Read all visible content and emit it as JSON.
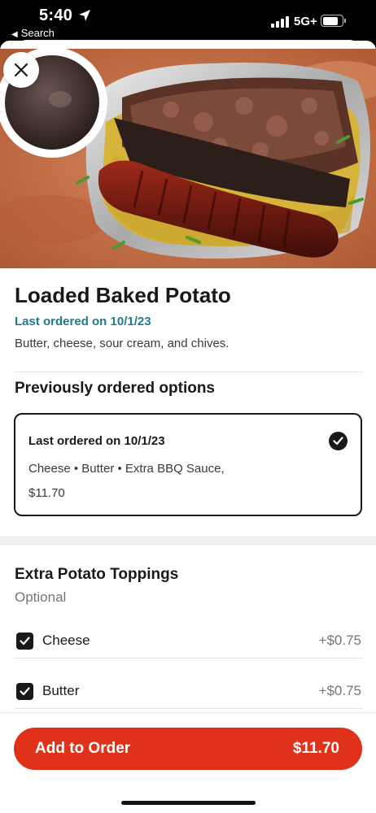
{
  "status_bar": {
    "time": "5:40",
    "back_label": "Search",
    "network": "5G+"
  },
  "item": {
    "title": "Loaded Baked Potato",
    "last_ordered": "Last ordered on 10/1/23",
    "description": "Butter, cheese, sour cream, and chives."
  },
  "previous": {
    "section_title": "Previously ordered options",
    "card_title": "Last ordered on 10/1/23",
    "card_items": "Cheese • Butter • Extra BBQ Sauce,",
    "card_price": "$11.70",
    "selected": true
  },
  "toppings": {
    "section_title": "Extra Potato Toppings",
    "subtitle": "Optional",
    "options": [
      {
        "label": "Cheese",
        "price": "+$0.75",
        "checked": true
      },
      {
        "label": "Butter",
        "price": "+$0.75",
        "checked": true
      }
    ]
  },
  "footer": {
    "button_label": "Add to Order",
    "button_price": "$11.70"
  },
  "colors": {
    "accent_red": "#e0321a",
    "link_teal": "#1f7a8c",
    "text_dark": "#191919",
    "text_muted": "#767676"
  },
  "icons": [
    "location-arrow-icon",
    "signal-icon",
    "battery-icon",
    "close-icon",
    "checkmark-icon"
  ]
}
